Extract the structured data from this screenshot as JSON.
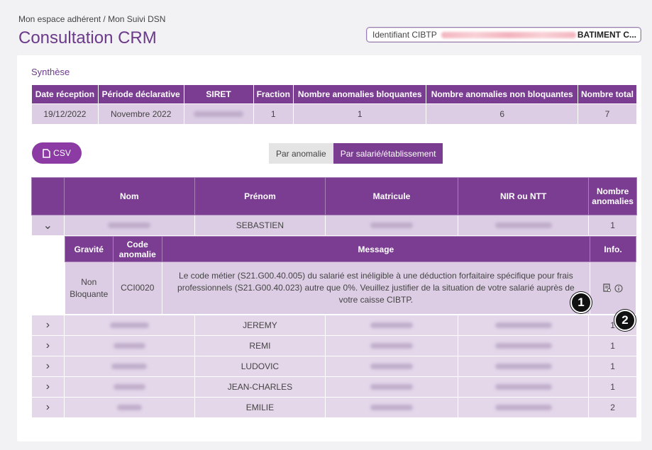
{
  "breadcrumb": "Mon espace adhérent / Mon Suivi DSN",
  "title": "Consultation CRM",
  "id_box": {
    "label": "Identifiant CIBTP",
    "company": "BATIMENT C..."
  },
  "synthese": {
    "title": "Synthèse",
    "headers": [
      "Date réception",
      "Période déclarative",
      "SIRET",
      "Fraction",
      "Nombre anomalies bloquantes",
      "Nombre anomalies non bloquantes",
      "Nombre total"
    ],
    "row": {
      "date": "19/12/2022",
      "periode": "Novembre 2022",
      "fraction": "1",
      "bloquantes": "1",
      "non_bloquantes": "6",
      "total": "7"
    }
  },
  "csv_label": "CSV",
  "toggle": {
    "par_anomalie": "Par anomalie",
    "par_salarie": "Par salarié/établissement"
  },
  "emp_headers": {
    "nom": "Nom",
    "prenom": "Prénom",
    "matricule": "Matricule",
    "nir": "NIR ou NTT",
    "nombre": "Nombre anomalies"
  },
  "employees": [
    {
      "prenom": "SEBASTIEN",
      "count": "1"
    },
    {
      "prenom": "JEREMY",
      "count": "1"
    },
    {
      "prenom": "REMI",
      "count": "1"
    },
    {
      "prenom": "LUDOVIC",
      "count": "1"
    },
    {
      "prenom": "JEAN-CHARLES",
      "count": "1"
    },
    {
      "prenom": "EMILIE",
      "count": "2"
    }
  ],
  "anomaly": {
    "headers": {
      "gravite": "Gravité",
      "code": "Code anomalie",
      "message": "Message",
      "info": "Info."
    },
    "gravite": "Non Bloquante",
    "code": "CCI0020",
    "message": "Le code métier (S21.G00.40.005) du salarié est inéligible à une déduction forfaitaire spécifique pour frais professionnels (S21.G00.40.023) autre que 0%. Veuillez justifier de la situation de votre salarié auprès de votre caisse CIBTP."
  },
  "badges": [
    "1",
    "2"
  ],
  "icons": {
    "csv": "document-icon",
    "expanded": "chevron-down-icon",
    "collapsed": "chevron-right-icon",
    "info_doc": "document-search-icon",
    "info": "info-icon"
  },
  "colors": {
    "primary": "#7b3d92",
    "accent": "#8b3ba3",
    "row": "#dccde4"
  }
}
